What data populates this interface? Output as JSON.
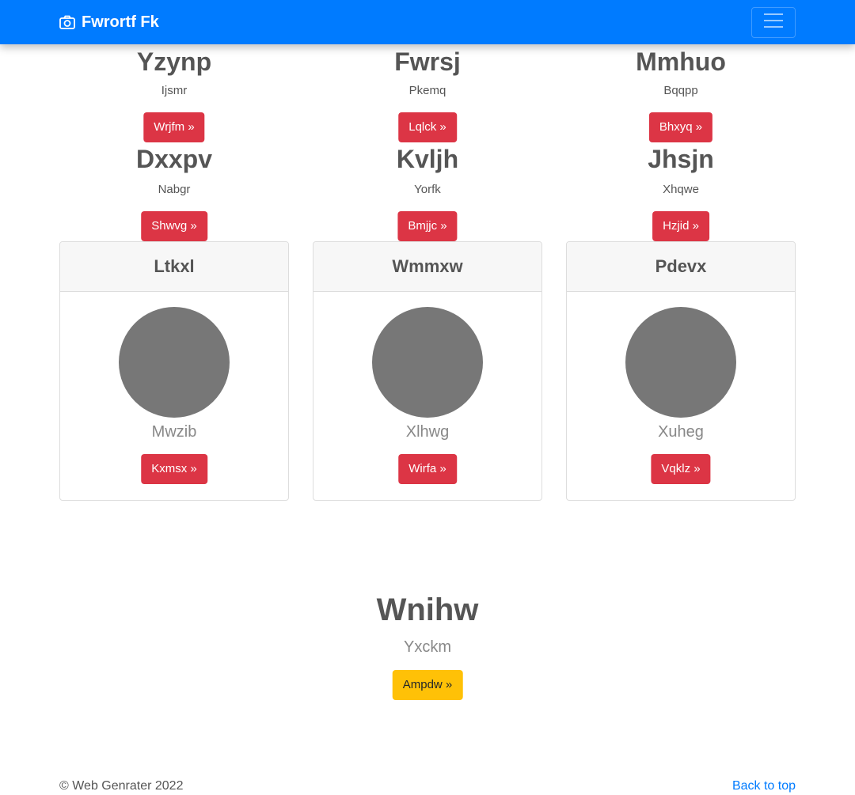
{
  "navbar": {
    "brand": "Fwrortf Fk",
    "brand_icon": "camera-icon",
    "toggler_icon": "hamburger-menu-icon",
    "bg_color": "#007bff"
  },
  "rows": [
    [
      {
        "title": "Yzynp",
        "subtitle": "Ijsmr",
        "button": "Wrjfm »"
      },
      {
        "title": "Fwrsj",
        "subtitle": "Pkemq",
        "button": "Lqlck »"
      },
      {
        "title": "Mmhuo",
        "subtitle": "Bqqpp",
        "button": "Bhxyq »"
      }
    ],
    [
      {
        "title": "Dxxpv",
        "subtitle": "Nabgr",
        "button": "Shwvg »"
      },
      {
        "title": "Kvljh",
        "subtitle": "Yorfk",
        "button": "Bmjjc »"
      },
      {
        "title": "Jhsjn",
        "subtitle": "Xhqwe",
        "button": "Hzjid »"
      }
    ]
  ],
  "cards": [
    {
      "header": "Ltkxl",
      "text": "Mwzib",
      "button": "Kxmsx »"
    },
    {
      "header": "Wmmxw",
      "text": "Xlhwg",
      "button": "Wirfa »"
    },
    {
      "header": "Pdevx",
      "text": "Xuheg",
      "button": "Vqklz »"
    }
  ],
  "hero": {
    "title": "Wnihw",
    "subtitle": "Yxckm",
    "button": "Ampdw »"
  },
  "footer": {
    "copyright": "© Web Genrater 2022",
    "back_to_top": "Back to top"
  },
  "colors": {
    "danger": "#dc3545",
    "warning": "#ffc107",
    "avatar": "#777777"
  }
}
